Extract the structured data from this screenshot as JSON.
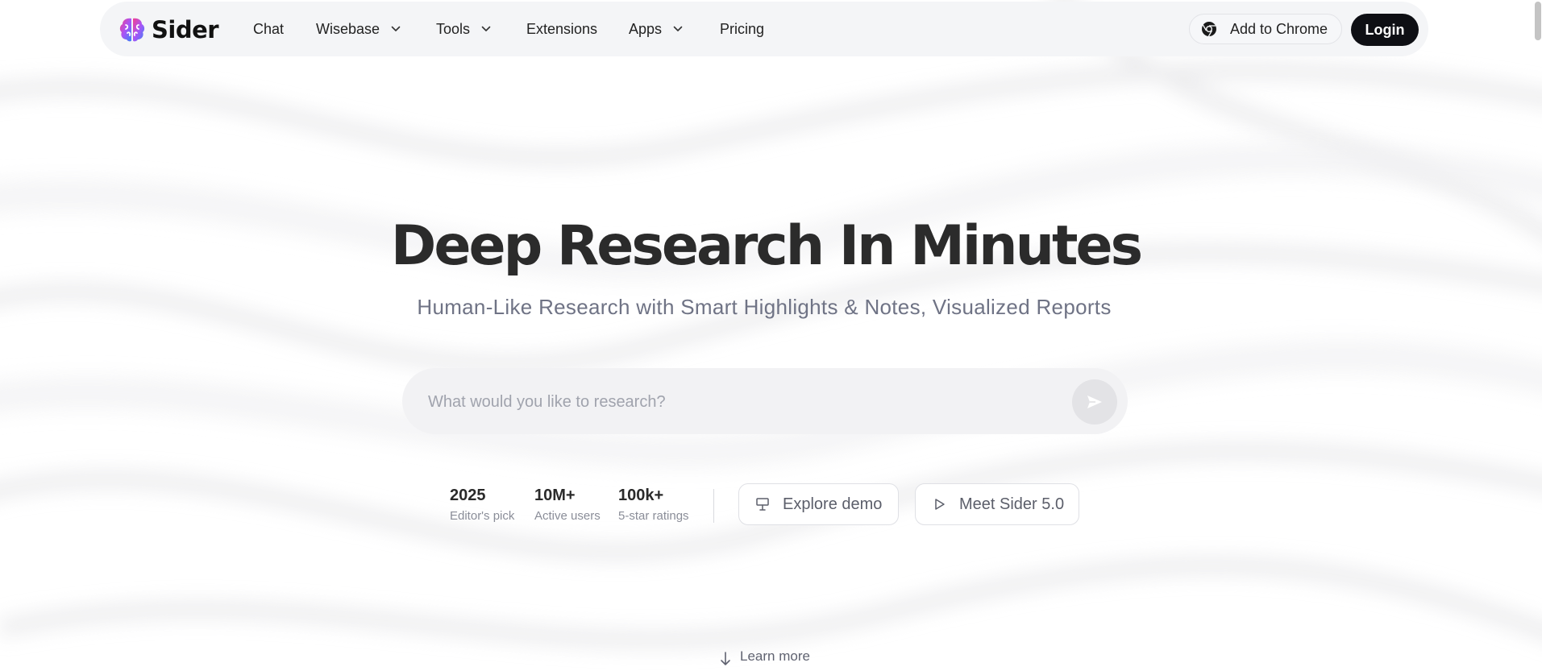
{
  "brand": {
    "name": "Sider"
  },
  "nav": {
    "chat": "Chat",
    "wisebase": "Wisebase",
    "tools": "Tools",
    "extensions": "Extensions",
    "apps": "Apps",
    "pricing": "Pricing",
    "add_to_chrome": "Add to Chrome",
    "login": "Login"
  },
  "hero": {
    "title": "Deep Research In Minutes",
    "subtitle": "Human-Like Research with Smart Highlights & Notes, Visualized Reports"
  },
  "search": {
    "placeholder": "What would you like to research?",
    "value": ""
  },
  "stats": [
    {
      "value": "2025",
      "label": "Editor's pick"
    },
    {
      "value": "10M+",
      "label": "Active users"
    },
    {
      "value": "100k+",
      "label": "5-star ratings"
    }
  ],
  "actions": {
    "explore_demo": "Explore demo",
    "meet_sider": "Meet Sider 5.0"
  },
  "footer": {
    "learn_more": "Learn more"
  },
  "icons": {
    "logo": "brain-logo-icon",
    "chevron": "chevron-down-icon",
    "chrome": "chrome-icon",
    "send": "send-icon",
    "demo": "presentation-icon",
    "play": "play-icon",
    "arrow": "arrow-down-icon"
  },
  "colors": {
    "login_bg": "#0e0f14",
    "nav_bg": "#f4f5f7",
    "title_text": "#2b2b2b",
    "subtitle_text": "#6f7385",
    "logo_gradient": [
      "#f43f8e",
      "#a855f7",
      "#3b82f6"
    ]
  }
}
